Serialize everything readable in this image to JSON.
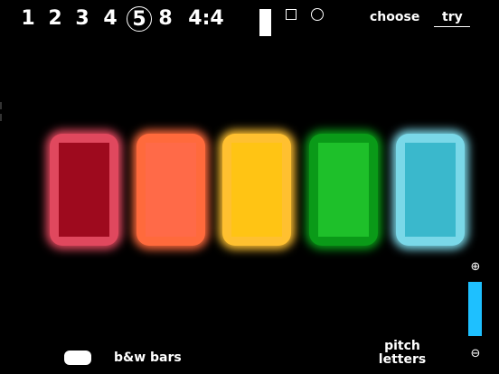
{
  "toolbar": {
    "numbers": [
      "1",
      "2",
      "3",
      "4",
      "5",
      "8",
      "4:4"
    ],
    "selected_number": "5",
    "choose_label": "choose",
    "try_label": "try",
    "mode_icons": [
      "bar-mode-icon",
      "square-mode-icon",
      "circle-mode-icon"
    ]
  },
  "bars": [
    {
      "color": "#9e0a1e",
      "glow": "#e0485e"
    },
    {
      "color": "#ff6a48",
      "glow": "#ff6a3c"
    },
    {
      "color": "#ffc414",
      "glow": "#ffc030"
    },
    {
      "color": "#1ec02a",
      "glow": "#0a9a18"
    },
    {
      "color": "#3ab8cc",
      "glow": "#7ad8e8"
    }
  ],
  "zoom": {
    "plus_icon": "zoom-in-icon",
    "minus_icon": "zoom-out-icon",
    "level": 1.0,
    "fill_color": "#1ec0ff"
  },
  "footer": {
    "bw_label": "b&w bars",
    "pitch_label_line1": "pitch",
    "pitch_label_line2": "letters"
  }
}
